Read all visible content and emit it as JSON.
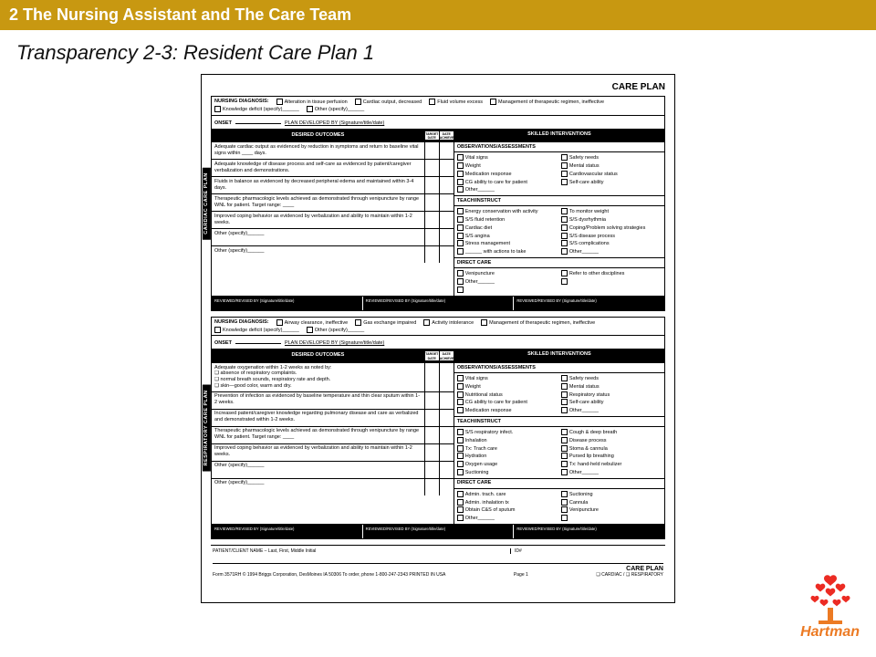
{
  "header_bar": "2 The Nursing Assistant and The Care Team",
  "title": "Transparency 2-3: Resident Care Plan 1",
  "page": {
    "care_plan_label": "CARE PLAN",
    "plans": [
      {
        "side_label": "CARDIAC CARE PLAN",
        "diagnosis_label": "NURSING DIAGNOSIS:",
        "diag_opts": [
          "Alteration in tissue perfusion",
          "Cardiac output, decreased",
          "Fluid volume excess",
          "Management of therapeutic regimen, ineffective",
          "Knowledge deficit (specify)______",
          "Other (specify)______"
        ],
        "onset_label": "ONSET",
        "plan_dev_label": "PLAN DEVELOPED BY (Signature/title/date)",
        "outcomes_header": "DESIRED OUTCOMES",
        "mini_headers": [
          "TARGET DATE",
          "DATE ACHIEVED"
        ],
        "interventions_header": "SKILLED INTERVENTIONS",
        "outcomes": [
          "Adequate cardiac output as evidenced by reduction in symptoms and return to baseline vital signs within ____ days.",
          "Adequate knowledge of disease process and self-care as evidenced by patient/caregiver verbalization and demonstrations.",
          "Fluids in balance as evidenced by decreased peripheral edema and maintained within 3-4 days.",
          "Therapeutic pharmacologic levels achieved as demonstrated through venipuncture by range WNL for patient. Target range: ____",
          "Improved coping behavior as evidenced by verbalization and ability to maintain within 1-2 weeks.",
          "Other (specify)______",
          "Other (specify)______"
        ],
        "sections": [
          {
            "title": "OBSERVATIONS/ASSESSMENTS",
            "items": [
              "Vital signs",
              "Safety needs",
              "Weight",
              "Mental status",
              "Medication response",
              "Cardiovascular status",
              "CG ability to care for patient",
              "Self-care ability",
              "Other______"
            ]
          },
          {
            "title": "TEACH/INSTRUCT",
            "items": [
              "Energy conservation with activity",
              "To monitor weight",
              "S/S fluid retention",
              "S/S dysrhythmia",
              "Cardiac diet",
              "Coping/Problem solving strategies",
              "S/S angina",
              "S/S disease process",
              "Stress management",
              "S/S complications",
              "______ with actions to take",
              "Other______"
            ]
          },
          {
            "title": "DIRECT CARE",
            "items": [
              "Venipuncture",
              "Refer to other disciplines",
              "Other______",
              "",
              ""
            ]
          }
        ],
        "reviewed_label": "REVIEWED/REVISED BY (Signature/title/date)"
      },
      {
        "side_label": "RESPIRATORY CARE PLAN",
        "diagnosis_label": "NURSING DIAGNOSIS:",
        "diag_opts": [
          "Airway clearance, ineffective",
          "Gas exchange impaired",
          "Activity intolerance",
          "Management of therapeutic regimen, ineffective",
          "Knowledge deficit (specify)______",
          "Other (specify)______"
        ],
        "onset_label": "ONSET",
        "plan_dev_label": "PLAN DEVELOPED BY (Signature/title/date)",
        "outcomes_header": "DESIRED OUTCOMES",
        "mini_headers": [
          "TARGET DATE",
          "DATE ACHIEVED"
        ],
        "interventions_header": "SKILLED INTERVENTIONS",
        "outcomes": [
          "Adequate oxygenation within 1-2 weeks as noted by:\n❑ absence of respiratory complaints.\n❑ normal breath sounds, respiratory rate and depth.\n❑ skin—good color, warm and dry.",
          "Prevention of infection as evidenced by baseline temperature and thin clear sputum within 1-2 weeks.",
          "Increased patient/caregiver knowledge regarding pulmonary disease and care as verbalized and demonstrated within 1-2 weeks.",
          "Therapeutic pharmacologic levels achieved as demonstrated through venipuncture by range WNL for patient. Target range: ____",
          "Improved coping behavior as evidenced by verbalization and ability to maintain within 1-2 weeks.",
          "Other (specify)______",
          "Other (specify)______"
        ],
        "sections": [
          {
            "title": "OBSERVATIONS/ASSESSMENTS",
            "items": [
              "Vital signs",
              "Safety needs",
              "Weight",
              "Mental status",
              "Nutritional status",
              "Respiratory status",
              "CG ability to care for patient",
              "Self-care ability",
              "Medication response",
              "Other______"
            ]
          },
          {
            "title": "TEACH/INSTRUCT",
            "items": [
              "S/S respiratory infect.",
              "Cough & deep breath",
              "Inhalation",
              "Disease process",
              "Tx: Trach care",
              "Stoma & cannula",
              "Hydration",
              "Pursed lip breathing",
              "Oxygen usage",
              "Tx: hand-held nebulizer",
              "Suctioning",
              "Other______"
            ]
          },
          {
            "title": "DIRECT CARE",
            "items": [
              "Admin. trach. care",
              "Suctioning",
              "Admin. inhalation tx",
              "Cannula",
              "Obtain C&S of sputum",
              "Venipuncture",
              "Other______",
              ""
            ]
          }
        ],
        "reviewed_label": "REVIEWED/REVISED BY (Signature/title/date)"
      }
    ],
    "footer": {
      "name_label": "PATIENT/CLIENT NAME – Last, First, Middle Initial",
      "id_label": "ID#",
      "form_line": "Form 3571RH   © 1994 Briggs Corporation, DesMoines IA 50306   To order, phone 1-800-247-2343 PRINTED IN USA",
      "page_num": "Page 1",
      "bottom_right_title": "CARE PLAN",
      "bottom_right_opts": "❑ CARDIAC / ❑ RESPIRATORY"
    },
    "logo_text": "Hartman"
  }
}
